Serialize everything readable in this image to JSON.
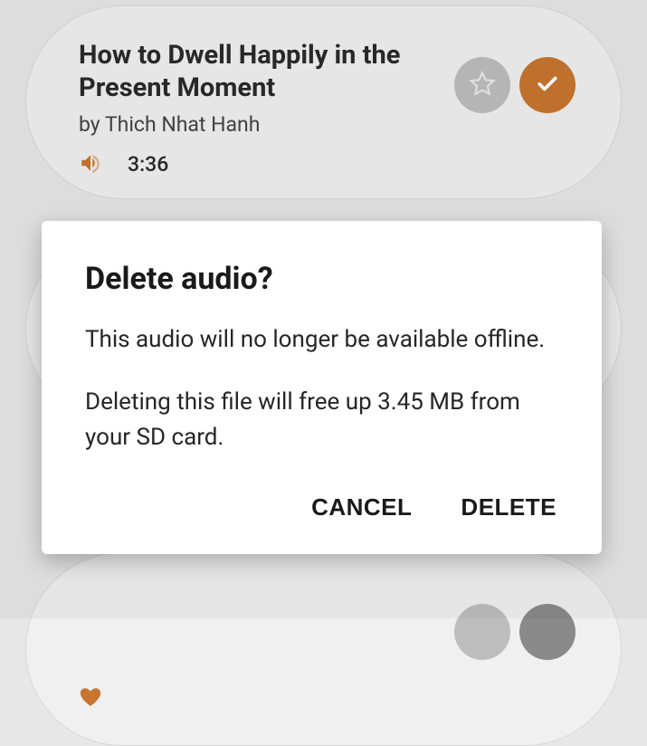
{
  "card": {
    "title": "How to Dwell Happily in the Present Moment",
    "author": "by Thich Nhat Hanh",
    "duration": "3:36"
  },
  "dialog": {
    "title": "Delete audio?",
    "body1": "This audio will no longer be available offline.",
    "body2": "Deleting this file will free up 3.45 MB from your SD card.",
    "cancel": "CANCEL",
    "delete": "DELETE"
  }
}
